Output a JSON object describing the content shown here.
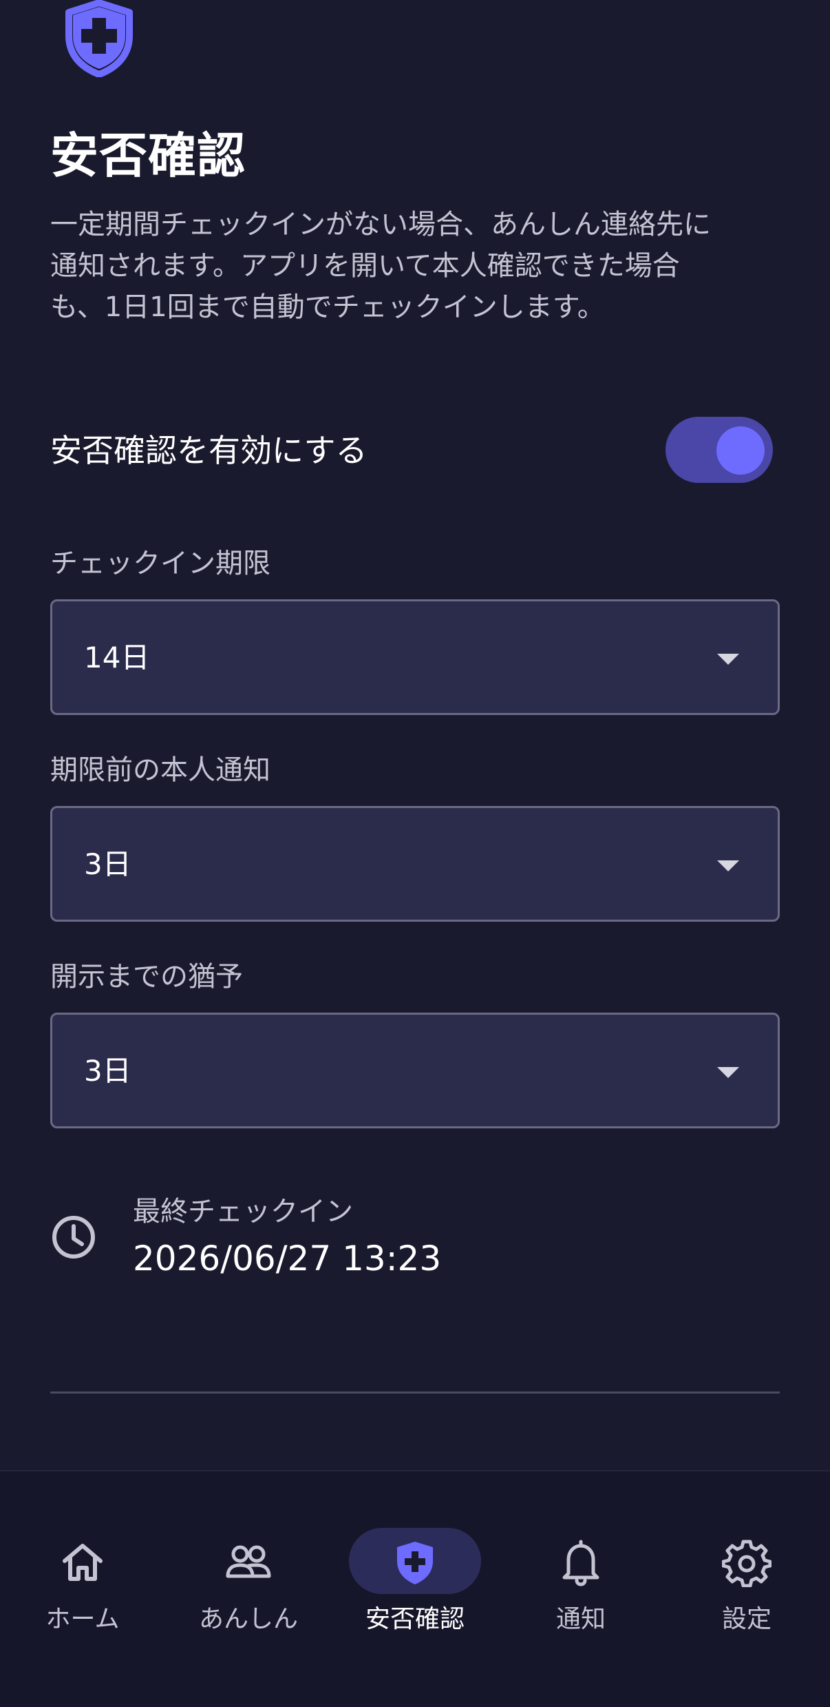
{
  "page": {
    "title": "安否確認",
    "description": "一定期間チェックインがない場合、あんしん連絡先に\n通知されます。アプリを開いて本人確認できた場合\nも、1日1回まで自動でチェックインします。"
  },
  "toggle": {
    "label": "安否確認を有効にする",
    "on": true
  },
  "fields": [
    {
      "label": "チェックイン期限",
      "value": "14日"
    },
    {
      "label": "期限前の本人通知",
      "value": "3日"
    },
    {
      "label": "開示までの猶予",
      "value": "3日"
    }
  ],
  "last_checkin": {
    "label": "最終チェックイン",
    "value": "2026/06/27 13:23"
  },
  "nav": {
    "items": [
      {
        "label": "ホーム",
        "icon": "home-icon"
      },
      {
        "label": "あんしん",
        "icon": "people-icon"
      },
      {
        "label": "安否確認",
        "icon": "shield-plus-icon",
        "active": true
      },
      {
        "label": "通知",
        "icon": "bell-icon"
      },
      {
        "label": "設定",
        "icon": "gear-icon"
      }
    ]
  },
  "colors": {
    "background": "#1a1a2e",
    "accent": "#6e6cff",
    "toggle_track": "#4a47a8",
    "select_bg": "#2b2b4b",
    "active_pill": "#2c2c5a"
  }
}
